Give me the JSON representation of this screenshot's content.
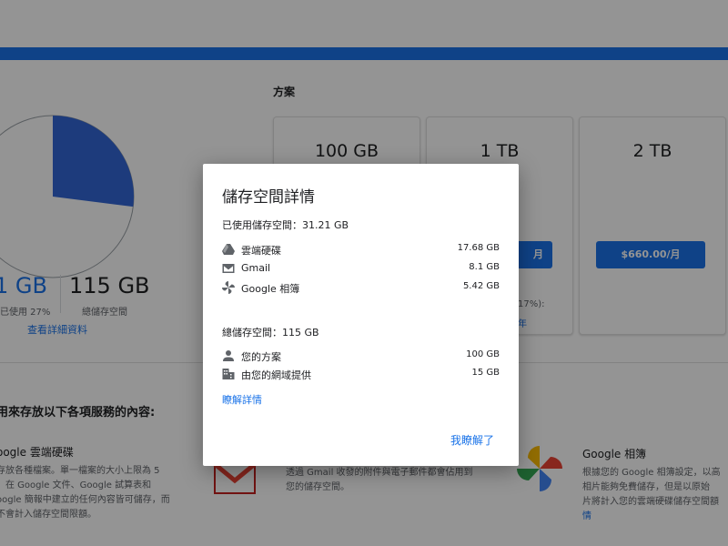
{
  "storage_overview": {
    "used_figure": "1 GB",
    "used_sub": "已使用 27%",
    "total_figure": "115 GB",
    "total_sub": "總儲存空間",
    "details_link": "查看詳細資料",
    "used_fraction": 0.27
  },
  "plans": {
    "heading": "方案",
    "cards": [
      {
        "size": "100 GB"
      },
      {
        "size": "1 TB",
        "price": "月",
        "note": "17%):",
        "note_link": "年"
      },
      {
        "size": "2 TB",
        "price": "$660.00/月"
      }
    ]
  },
  "services": {
    "heading": "用來存放以下各項服務的內容:",
    "drive": {
      "title": "oogle 雲端硬碟",
      "desc": "存放各種檔案。單一檔案的大小上限為 5\n。在 Google 文件、Google 試算表和\noogle 簡報中建立的任何內容皆可儲存，而\n不會計入儲存空間限額。"
    },
    "gmail": {
      "desc": "透過 Gmail 收發的附件與電子郵件都會佔用到\n您的儲存空間。"
    },
    "photos": {
      "title": "Google 相簿",
      "desc": "根據您的 Google 相簿設定，以高\n相片能夠免費儲存，但是以原始",
      "desc2": "片將計入您的雲端硬碟儲存空間額",
      "link": "情"
    }
  },
  "dialog": {
    "title": "儲存空間詳情",
    "used_label": "已使用儲存空間：31.21 GB",
    "used_items": [
      {
        "icon": "drive-icon",
        "label": "雲端硬碟",
        "value": "17.68 GB"
      },
      {
        "icon": "gmail-icon",
        "label": "Gmail",
        "value": "8.1 GB"
      },
      {
        "icon": "photos-icon",
        "label": "Google 相簿",
        "value": "5.42 GB"
      }
    ],
    "total_label": "總儲存空間：115 GB",
    "total_items": [
      {
        "icon": "person-icon",
        "label": "您的方案",
        "value": "100 GB"
      },
      {
        "icon": "domain-icon",
        "label": "由您的網域提供",
        "value": "15 GB"
      }
    ],
    "learn_more": "瞭解詳情",
    "ok_button": "我瞭解了"
  },
  "colors": {
    "accent": "#1a73e8",
    "pie_fill": "#3367d6",
    "scrim": "rgba(0,0,0,0.42)"
  }
}
